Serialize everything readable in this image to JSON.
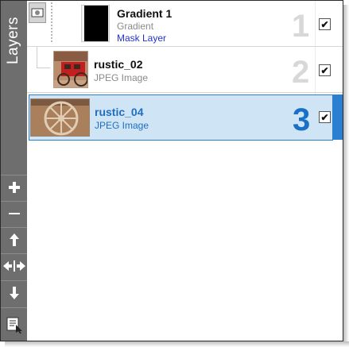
{
  "panel": {
    "title": "Layers"
  },
  "toolbar": [
    {
      "name": "add-layer-button",
      "icon": "plus-icon"
    },
    {
      "name": "remove-layer-button",
      "icon": "minus-icon"
    },
    {
      "name": "move-up-button",
      "icon": "arrow-up-icon"
    },
    {
      "name": "move-horizontal-button",
      "icon": "arrows-left-right-icon"
    },
    {
      "name": "move-down-button",
      "icon": "arrow-down-icon"
    },
    {
      "name": "layer-options-button",
      "icon": "layer-options-icon"
    }
  ],
  "layers": [
    {
      "number": "1",
      "name": "Gradient 1",
      "type": "Gradient",
      "extra": "Mask Layer",
      "checked": true,
      "selected": false,
      "thumb": "black-gradient-mask"
    },
    {
      "number": "2",
      "name": "rustic_02",
      "type": "JPEG Image",
      "checked": true,
      "selected": false,
      "thumb": "red-stagecoach-photo"
    },
    {
      "number": "3",
      "name": "rustic_04",
      "type": "JPEG Image",
      "checked": true,
      "selected": true,
      "thumb": "wagon-wheel-photo"
    }
  ],
  "colors": {
    "sidebar": "#6e6e6e",
    "selection_bg": "#cfe4f4",
    "selection_accent": "#1a6fc6",
    "mask_link_text": "#2233cc"
  },
  "check_mark": "✔"
}
